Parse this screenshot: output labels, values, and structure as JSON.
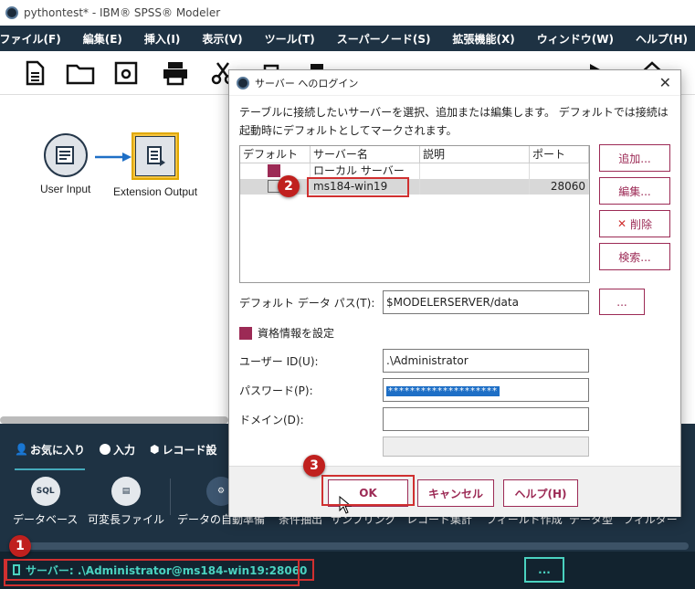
{
  "window": {
    "title": "pythontest* - IBM® SPSS® Modeler"
  },
  "menu": [
    "ファイル(F)",
    "編集(E)",
    "挿入(I)",
    "表示(V)",
    "ツール(T)",
    "スーパーノード(S)",
    "拡張機能(X)",
    "ウィンドウ(W)",
    "ヘルプ(H)"
  ],
  "canvas": {
    "nodes": [
      {
        "label": "User Input"
      },
      {
        "label": "Extension Output"
      }
    ]
  },
  "palette": {
    "tabs": [
      "お気に入り",
      "入力",
      "レコード設"
    ],
    "items": [
      "データベース",
      "可変長ファイル",
      "データの自動準備",
      "条件抽出",
      "サンプリング",
      "レコード集計",
      "フィールド作成",
      "データ型",
      "フィルター"
    ],
    "db_icon_text": "SQL"
  },
  "status": {
    "server": "サーバー: .\\Administrator@ms184-win19:28060",
    "more": "..."
  },
  "dialog": {
    "title": "サーバー へのログイン",
    "close": "✕",
    "description": "テーブルに接続したいサーバーを選択、追加または編集します。 デフォルトでは接続は起動時にデフォルトとしてマークされます。",
    "table": {
      "headers": [
        "デフォルト",
        "サーバー名",
        "説明",
        "ポート"
      ],
      "rows": [
        {
          "default": true,
          "name": "ローカル サーバー",
          "desc": "",
          "port": ""
        },
        {
          "default": false,
          "name": "ms184-win19",
          "desc": "",
          "port": "28060"
        }
      ]
    },
    "buttons": {
      "add": "追加...",
      "edit": "編集...",
      "delete": "削除",
      "search": "検索..."
    },
    "default_path_label": "デフォルト データ パス(T):",
    "default_path_value": "$MODELERSERVER/data",
    "browse": "...",
    "credentials_label": "資格情報を設定",
    "credentials_checked": true,
    "user_label": "ユーザー ID(U):",
    "user_value": ".\\Administrator",
    "password_label": "パスワード(P):",
    "password_value": "********************",
    "domain_label": "ドメイン(D):",
    "domain_value": "",
    "ok": "OK",
    "cancel": "キャンセル",
    "help": "ヘルプ(H)"
  },
  "annotations": [
    "1",
    "2",
    "3"
  ],
  "colors": {
    "accent": "#9c2a55",
    "dark_bar": "#1e3243",
    "status_text": "#4ad2c0",
    "annotation_red": "#d03030"
  }
}
